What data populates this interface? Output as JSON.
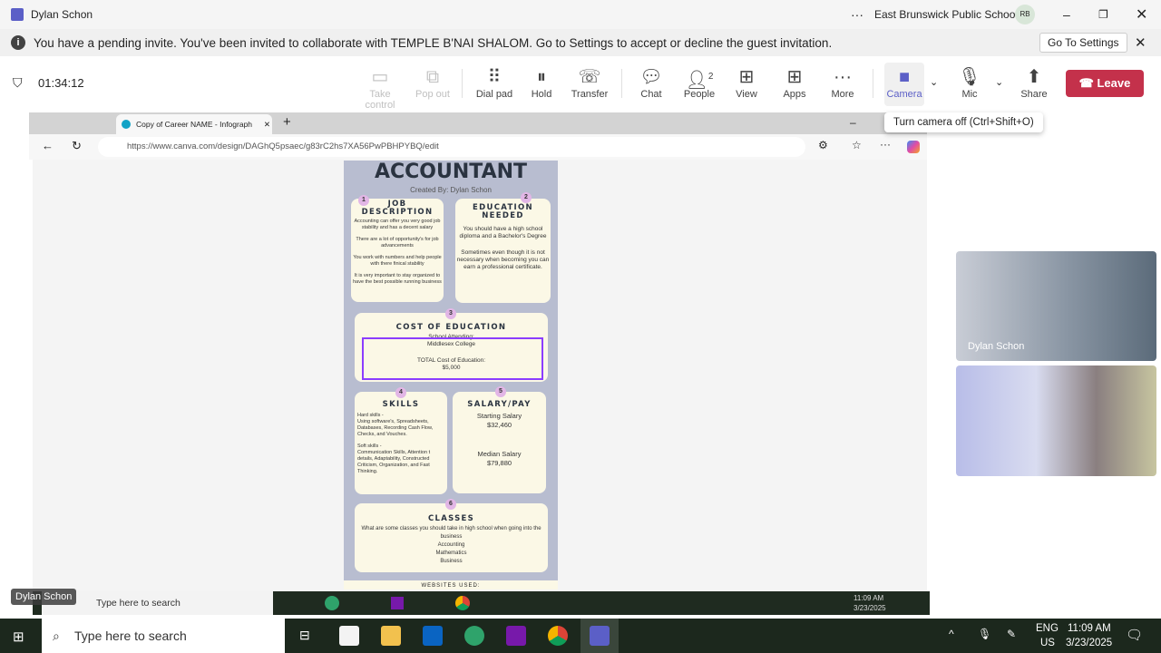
{
  "window": {
    "title": "Dylan Schon",
    "org": "East Brunswick Public Schools",
    "avatar": "RB"
  },
  "banner": {
    "message": "You have a pending invite. You've been invited to collaborate with TEMPLE B'NAI SHALOM. Go to Settings to accept or decline the guest invitation.",
    "button": "Go To Settings"
  },
  "call": {
    "timer": "01:34:12"
  },
  "toolbar": {
    "take_control": "Take control",
    "pop_out": "Pop out",
    "dial_pad": "Dial pad",
    "hold": "Hold",
    "transfer": "Transfer",
    "chat": "Chat",
    "people": "People",
    "people_count": "2",
    "view": "View",
    "apps": "Apps",
    "more": "More",
    "camera": "Camera",
    "mic": "Mic",
    "share": "Share",
    "leave": "Leave"
  },
  "tooltip": "Turn camera off (Ctrl+Shift+O)",
  "browser": {
    "tab_title": "Copy of Career NAME - Infograph",
    "url": "https://www.canva.com/design/DAGhQ5psaec/g83rC2hs7XA56PwPBHPYBQ/edit"
  },
  "design": {
    "title": "ACCOUNTANT",
    "subtitle": "Created By: Dylan Schon",
    "s1": {
      "n": "1",
      "title": "JOB DESCRIPTION",
      "lines": [
        "Accounting can offer you very good job stability and has a decent salary",
        "There are a lot of opportunity's for job advancements",
        "You work with numbers and help people with there finical stability",
        "It is very important to stay organized to have the best possible running business"
      ]
    },
    "s2": {
      "n": "2",
      "title": "EDUCATION NEEDED",
      "lines": [
        "You should have a high school diploma and a Bachelor's Degree",
        "Sometimes even though it is not necessary when becoming you can earn a professional certificate."
      ]
    },
    "s3": {
      "n": "3",
      "title": "COST OF EDUCATION",
      "lines": [
        "School Attending:",
        "Middlesex College",
        "TOTAL Cost of Education:",
        "$5,000"
      ]
    },
    "s4": {
      "n": "4",
      "title": "SKILLS",
      "lines": [
        "Hard skills -",
        "Using software's, Spreadsheets, Databases, Recording Cash Flow, Checks, and Vouches.",
        "Soft skills -",
        "Communication Skills, Attention t details, Adaptability, Constructed Criticism, Organization, and Fast Thinking."
      ]
    },
    "s5": {
      "n": "5",
      "title": "SALARY/PAY",
      "lines": [
        "Starting Salary",
        "$32,460",
        "Median Salary",
        "$79,880"
      ]
    },
    "s6": {
      "n": "6",
      "title": "CLASSES",
      "lines": [
        "What are some classes you should take in high school when going into the business",
        "Accounting",
        "Mathematics",
        "Business"
      ]
    },
    "footer": "WEBSITES USED:"
  },
  "remote_taskbar": {
    "search": "Type here to search",
    "time": "11:09 AM",
    "date": "3/23/2025",
    "name_label": "Dylan Schon"
  },
  "videos": [
    {
      "name": "Dylan Schon"
    },
    {
      "name": ""
    }
  ],
  "taskbar": {
    "search": "Type here to search",
    "lang1": "ENG",
    "lang2": "US",
    "time": "11:09 AM",
    "date": "3/23/2025"
  }
}
